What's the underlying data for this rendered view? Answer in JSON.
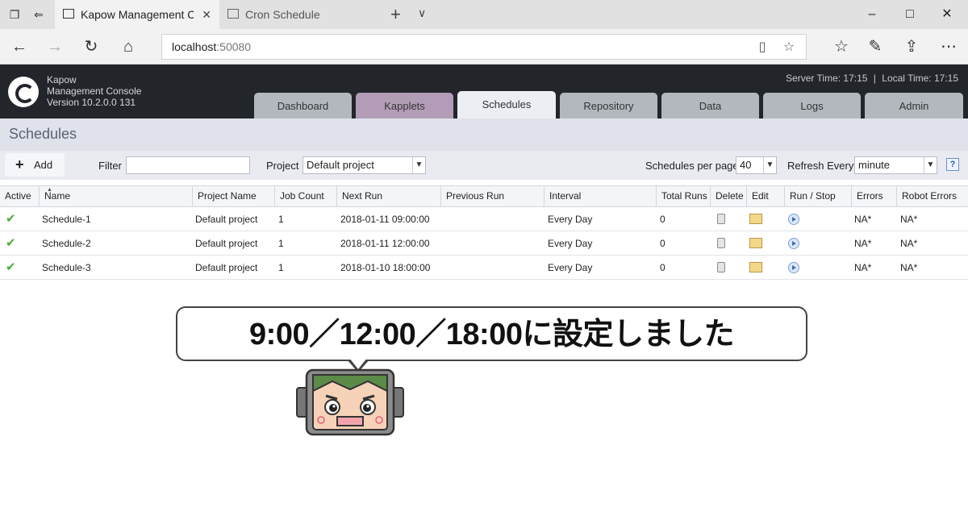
{
  "browser": {
    "tabs": [
      {
        "label": "Kapow Management Cc"
      },
      {
        "label": "Cron Schedule"
      }
    ],
    "address": {
      "host": "localhost",
      "port": ":50080"
    }
  },
  "app": {
    "brand_lines": [
      "Kapow",
      "Management Console",
      "Version 10.2.0.0 131"
    ],
    "server_time": "Server Time: 17:15",
    "separator": "|",
    "local_time": "Local Time: 17:15",
    "tabs": [
      "Dashboard",
      "Kapplets",
      "Schedules",
      "Repository",
      "Data",
      "Logs",
      "Admin"
    ],
    "active_tab": "Schedules"
  },
  "page": {
    "title": "Schedules",
    "toolbar": {
      "add_label": "Add",
      "filter_label": "Filter",
      "filter_value": "",
      "project_label": "Project",
      "project_value": "Default project",
      "per_page_label": "Schedules per page",
      "per_page_value": "40",
      "refresh_label": "Refresh Every",
      "refresh_value": "minute",
      "help_label": "?"
    }
  },
  "table": {
    "columns": [
      "Active",
      "Name",
      "Project Name",
      "Job Count",
      "Next Run",
      "Previous Run",
      "Interval",
      "Total Runs",
      "Delete",
      "Edit",
      "Run / Stop",
      "Errors",
      "Robot Errors"
    ],
    "rows": [
      {
        "active": true,
        "name": "Schedule-1",
        "project": "Default project",
        "job_count": "1",
        "next_run": "2018-01-11 09:00:00",
        "previous_run": "",
        "interval": "Every Day",
        "total_runs": "0",
        "errors": "NA*",
        "robot_errors": "NA*"
      },
      {
        "active": true,
        "name": "Schedule-2",
        "project": "Default project",
        "job_count": "1",
        "next_run": "2018-01-11 12:00:00",
        "previous_run": "",
        "interval": "Every Day",
        "total_runs": "0",
        "errors": "NA*",
        "robot_errors": "NA*"
      },
      {
        "active": true,
        "name": "Schedule-3",
        "project": "Default project",
        "job_count": "1",
        "next_run": "2018-01-10 18:00:00",
        "previous_run": "",
        "interval": "Every Day",
        "total_runs": "0",
        "errors": "NA*",
        "robot_errors": "NA*"
      }
    ]
  },
  "callout": {
    "text": "9:00／12:00／18:00に設定しました"
  },
  "colors": {
    "header_bg": "#22262b",
    "tab_inactive": "#b3b8bf",
    "tab_kapplets": "#b29cb6",
    "tab_active": "#eceef3",
    "check_green": "#4caa3c"
  }
}
